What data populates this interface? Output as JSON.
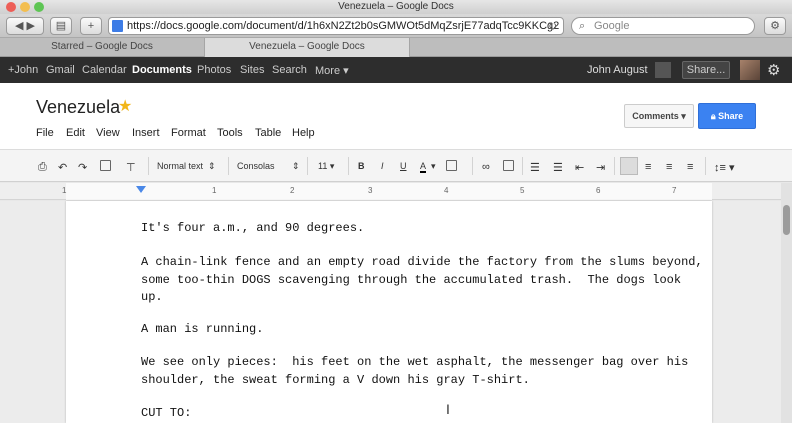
{
  "window": {
    "title": "Venezuela – Google Docs"
  },
  "browser": {
    "url": "https://docs.google.com/document/d/1h6xN2Zt2b0sGMWOt5dMqZsrjE77adqTcc9KKCg2",
    "search_placeholder": "Google",
    "tabs": [
      {
        "label": "Starred – Google Docs"
      },
      {
        "label": "Venezuela – Google Docs"
      }
    ]
  },
  "gbar": {
    "links": [
      "+John",
      "Gmail",
      "Calendar",
      "Documents",
      "Photos",
      "Sites",
      "Search",
      "More ▾"
    ],
    "user": "John August",
    "share_label": "Share..."
  },
  "doc": {
    "title": "Venezuela",
    "menu": [
      "File",
      "Edit",
      "View",
      "Insert",
      "Format",
      "Tools",
      "Table",
      "Help"
    ],
    "comments_label": "Comments",
    "share_label": "Share"
  },
  "format_toolbar": {
    "style": "Normal text",
    "font": "Consolas",
    "size": "11",
    "bold": "B",
    "italic": "I",
    "underline": "U",
    "text_color": "A"
  },
  "ruler": {
    "numbers": [
      "1",
      "1",
      "2",
      "3",
      "4",
      "5",
      "6",
      "7"
    ]
  },
  "content": {
    "p1": "It's four a.m., and 90 degrees.",
    "p2": "A chain-link fence and an empty road divide the factory from the slums beyond,\nsome too-thin DOGS scavenging through the accumulated trash.  The dogs look\nup.",
    "p3": "A man is running.",
    "p4": "We see only pieces:  his feet on the wet asphalt, the messenger bag over his\nshoulder, the sweat forming a V down his gray T-shirt.",
    "p5": "CUT TO:"
  },
  "colors": {
    "accent": "#3b82f1",
    "star": "#f2b619",
    "gbar_bg": "#2d2d2d"
  }
}
